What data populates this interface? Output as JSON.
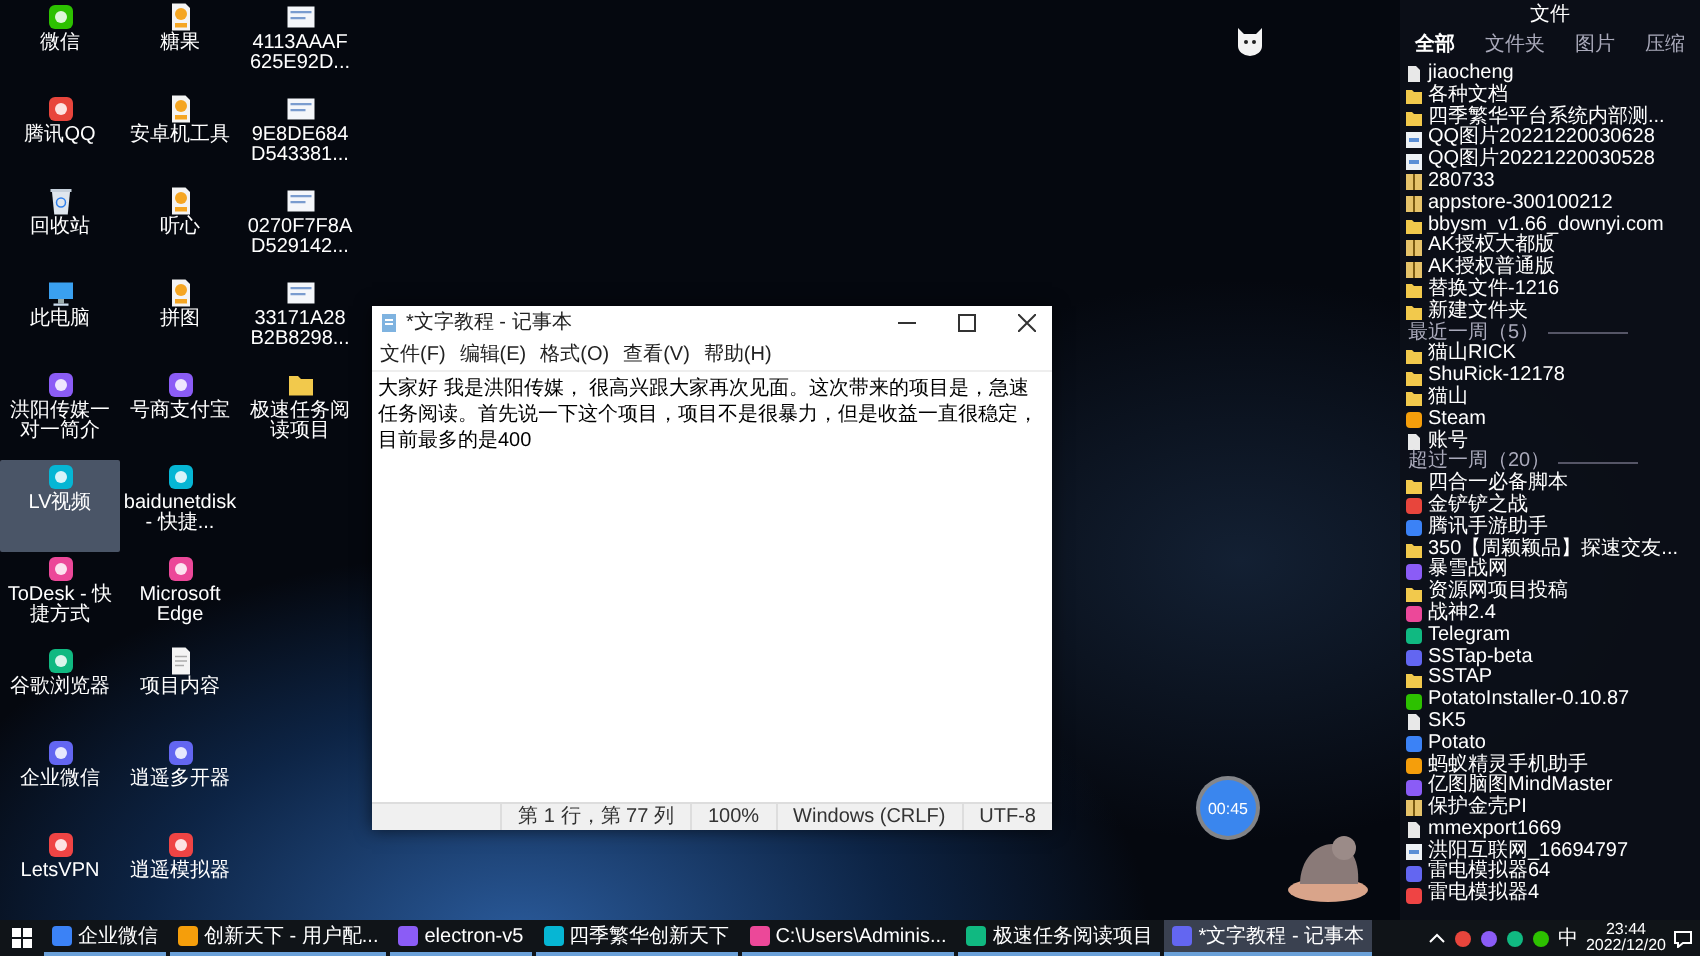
{
  "desktop_icons": [
    {
      "label": "微信",
      "kind": "app",
      "selected": false
    },
    {
      "label": "腾讯QQ",
      "kind": "app",
      "selected": false
    },
    {
      "label": "回收站",
      "kind": "recycle_bin",
      "selected": false
    },
    {
      "label": "此电脑",
      "kind": "computer",
      "selected": false
    },
    {
      "label": "洪阳传媒一对一简介",
      "kind": "app",
      "selected": false
    },
    {
      "label": "LV视频",
      "kind": "app",
      "selected": true
    },
    {
      "label": "ToDesk - 快捷方式",
      "kind": "app",
      "selected": false
    },
    {
      "label": "谷歌浏览器",
      "kind": "app",
      "selected": false
    },
    {
      "label": "企业微信",
      "kind": "app",
      "selected": false
    },
    {
      "label": "LetsVPN",
      "kind": "app",
      "selected": false
    },
    {
      "label": "糖果",
      "kind": "apk",
      "selected": false
    },
    {
      "label": "安卓机工具",
      "kind": "apk",
      "selected": false
    },
    {
      "label": "听心",
      "kind": "apk",
      "selected": false
    },
    {
      "label": "拼图",
      "kind": "apk",
      "selected": false
    },
    {
      "label": "号商支付宝",
      "kind": "app",
      "selected": false
    },
    {
      "label": "baidunetdisk - 快捷...",
      "kind": "app",
      "selected": false
    },
    {
      "label": "Microsoft Edge",
      "kind": "app",
      "selected": false
    },
    {
      "label": "项目内容",
      "kind": "document",
      "selected": false
    },
    {
      "label": "逍遥多开器",
      "kind": "app",
      "selected": false
    },
    {
      "label": "逍遥模拟器",
      "kind": "app",
      "selected": false
    },
    {
      "label": "4113AAAF 625E92D...",
      "kind": "image",
      "selected": false
    },
    {
      "label": "9E8DE684 D543381...",
      "kind": "image",
      "selected": false
    },
    {
      "label": "0270F7F8A D529142...",
      "kind": "image",
      "selected": false
    },
    {
      "label": "33171A28 B2B8298...",
      "kind": "image",
      "selected": false
    },
    {
      "label": "极速任务阅读项目",
      "kind": "folder",
      "selected": false
    }
  ],
  "notepad": {
    "title": "*文字教程 - 记事本",
    "menu": [
      "文件(F)",
      "编辑(E)",
      "格式(O)",
      "查看(V)",
      "帮助(H)"
    ],
    "text": "大家好 我是洪阳传媒， 很高兴跟大家再次见面。这次带来的项目是，急速任务阅读。首先说一下这个项目，项目不是很暴力，但是收益一直很稳定，目前最多的是400",
    "status": [
      "第 1 行，第 77 列",
      "100%",
      "Windows (CRLF)",
      "UTF-8"
    ]
  },
  "file_panel": {
    "title": "文件",
    "tabs": [
      {
        "label": "全部",
        "selected": true
      },
      {
        "label": "文件夹",
        "selected": false
      },
      {
        "label": "图片",
        "selected": false
      },
      {
        "label": "压缩",
        "selected": false
      }
    ],
    "sections": [
      {
        "items": [
          {
            "label": "jiaocheng",
            "kind": "file"
          },
          {
            "label": "各种文档",
            "kind": "folder"
          },
          {
            "label": "四季繁华平台系统内部测...",
            "kind": "folder"
          },
          {
            "label": "QQ图片20221220030628",
            "kind": "image"
          },
          {
            "label": "QQ图片20221220030528",
            "kind": "image"
          },
          {
            "label": "280733",
            "kind": "archive"
          },
          {
            "label": "appstore-300100212",
            "kind": "archive"
          },
          {
            "label": "bbysm_v1.66_downyi.com",
            "kind": "folder"
          },
          {
            "label": "AK授权大都版",
            "kind": "archive"
          },
          {
            "label": "AK授权普通版",
            "kind": "archive"
          },
          {
            "label": "替换文件-1216",
            "kind": "folder"
          },
          {
            "label": "新建文件夹",
            "kind": "folder"
          }
        ]
      },
      {
        "heading": "最近一周（5）",
        "items": [
          {
            "label": "猫山RICK",
            "kind": "folder"
          },
          {
            "label": "ShuRick-12178",
            "kind": "folder"
          },
          {
            "label": "猫山",
            "kind": "folder"
          },
          {
            "label": "Steam",
            "kind": "app"
          },
          {
            "label": "账号",
            "kind": "file"
          }
        ]
      },
      {
        "heading": "超过一周（20）",
        "items": [
          {
            "label": "四合一必备脚本",
            "kind": "folder"
          },
          {
            "label": "金铲铲之战",
            "kind": "app"
          },
          {
            "label": "腾讯手游助手",
            "kind": "app"
          },
          {
            "label": "350【周颖颖品】探速交友...",
            "kind": "folder"
          },
          {
            "label": "暴雪战网",
            "kind": "app"
          },
          {
            "label": "资源网项目投稿",
            "kind": "folder"
          },
          {
            "label": "战神2.4",
            "kind": "app"
          },
          {
            "label": "Telegram",
            "kind": "app"
          },
          {
            "label": "SSTap-beta",
            "kind": "app"
          },
          {
            "label": "SSTAP",
            "kind": "folder"
          },
          {
            "label": "PotatoInstaller-0.10.87",
            "kind": "app"
          },
          {
            "label": "SK5",
            "kind": "file"
          },
          {
            "label": "Potato",
            "kind": "app"
          },
          {
            "label": "蚂蚁精灵手机助手",
            "kind": "app"
          },
          {
            "label": "亿图脑图MindMaster",
            "kind": "app"
          },
          {
            "label": "保护金壳PI",
            "kind": "archive"
          },
          {
            "label": "mmexport1669",
            "kind": "file"
          },
          {
            "label": "洪阳互联网_16694797",
            "kind": "image"
          },
          {
            "label": "雷电模拟器64",
            "kind": "app"
          },
          {
            "label": "雷电模拟器4",
            "kind": "app"
          }
        ]
      }
    ]
  },
  "timer_badge": "00:45",
  "taskbar": {
    "tasks": [
      {
        "label": "企业微信",
        "selected": false
      },
      {
        "label": "创新天下 - 用户配...",
        "selected": false
      },
      {
        "label": "electron-v5",
        "selected": false
      },
      {
        "label": "四季繁华创新天下",
        "selected": false
      },
      {
        "label": "C:\\Users\\Adminis...",
        "selected": false
      },
      {
        "label": "极速任务阅读项目",
        "selected": false
      },
      {
        "label": "*文字教程 - 记事本",
        "selected": true
      }
    ],
    "input_method": "中",
    "time": "23:44",
    "date": "2022/12/20"
  }
}
